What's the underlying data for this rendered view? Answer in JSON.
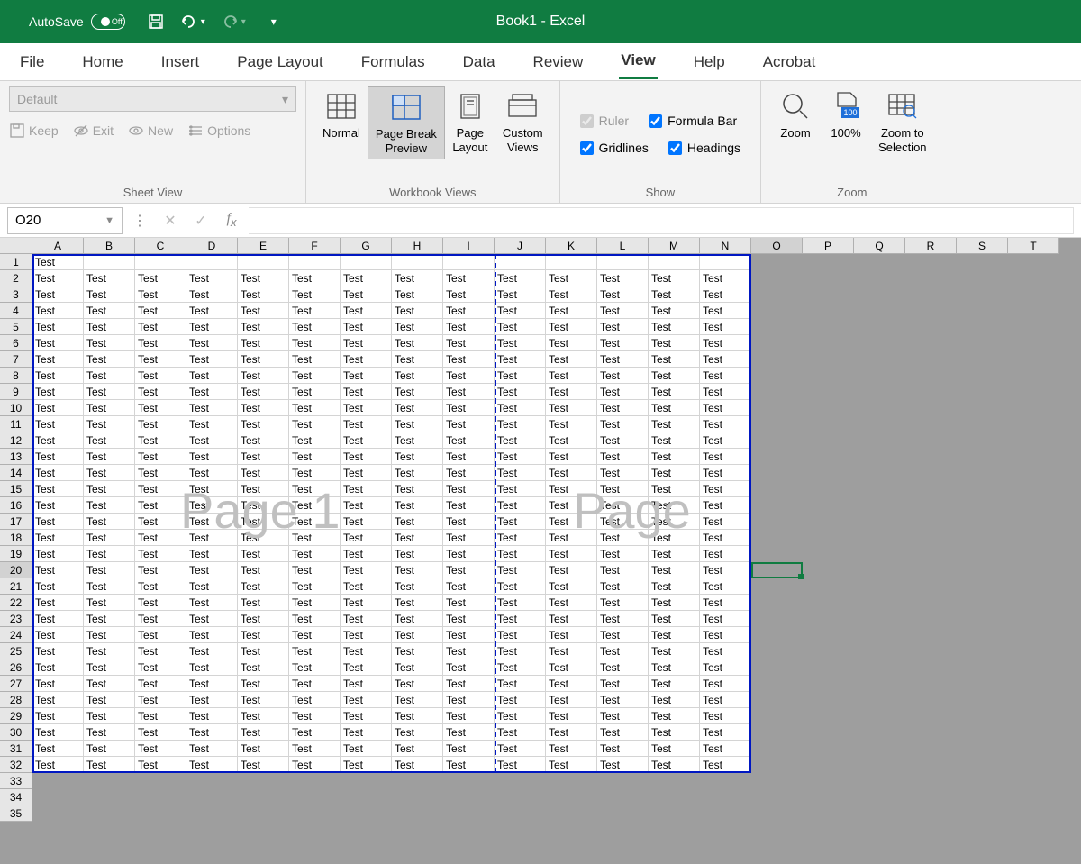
{
  "titlebar": {
    "autosave_label": "AutoSave",
    "autosave_state": "Off",
    "title": "Book1 - Excel"
  },
  "tabs": [
    "File",
    "Home",
    "Insert",
    "Page Layout",
    "Formulas",
    "Data",
    "Review",
    "View",
    "Help",
    "Acrobat"
  ],
  "active_tab": "View",
  "sheet_view": {
    "dropdown": "Default",
    "keep": "Keep",
    "exit": "Exit",
    "new": "New",
    "options": "Options",
    "label": "Sheet View"
  },
  "workbook_views": {
    "normal": "Normal",
    "page_break": "Page Break\nPreview",
    "page_layout": "Page\nLayout",
    "custom": "Custom\nViews",
    "label": "Workbook Views"
  },
  "show": {
    "ruler": "Ruler",
    "formula_bar": "Formula Bar",
    "gridlines": "Gridlines",
    "headings": "Headings",
    "label": "Show"
  },
  "zoom": {
    "zoom": "Zoom",
    "hundred": "100%",
    "to_selection": "Zoom to\nSelection",
    "label": "Zoom"
  },
  "namebox": "O20",
  "columns": [
    "A",
    "B",
    "C",
    "D",
    "E",
    "F",
    "G",
    "H",
    "I",
    "J",
    "K",
    "L",
    "M",
    "N",
    "O",
    "P",
    "Q",
    "R",
    "S",
    "T"
  ],
  "data_columns": 14,
  "visible_rows": 35,
  "data_rows": 32,
  "cell_text": "Test",
  "watermarks": {
    "p1": "Page 1",
    "p2": "Page"
  },
  "selected": {
    "col": 14,
    "row": 19
  }
}
